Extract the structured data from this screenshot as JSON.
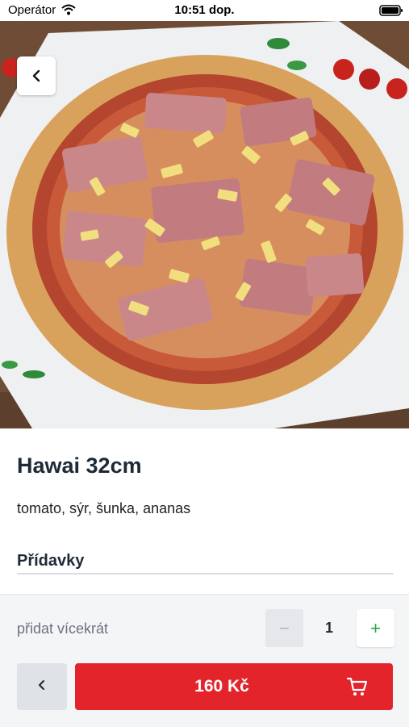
{
  "status_bar": {
    "carrier": "Operátor",
    "time": "10:51 dop."
  },
  "product": {
    "title": "Hawai 32cm",
    "description": "tomato, sýr, šunka, ananas"
  },
  "addons": {
    "label": "Přídavky"
  },
  "quantity": {
    "label": "přidat vícekrát",
    "minus": "−",
    "value": "1",
    "plus": "+"
  },
  "checkout": {
    "price_label": "160 Kč"
  },
  "icons": {
    "back_top": "chevron-left-icon",
    "back_bottom": "chevron-left-icon",
    "cart": "cart-icon",
    "wifi": "wifi-icon",
    "battery": "battery-icon"
  },
  "colors": {
    "accent": "#e3242b",
    "plus": "#28a745",
    "title": "#1f2a37"
  }
}
